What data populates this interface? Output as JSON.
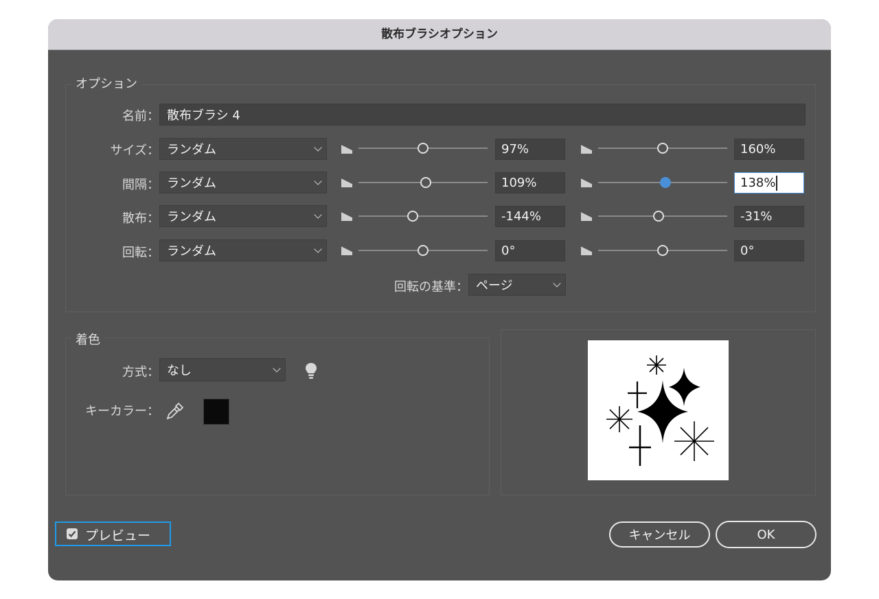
{
  "dialog": {
    "title": "散布ブラシオプション"
  },
  "options": {
    "group_title": "オプション",
    "name_label": "名前：",
    "name_value": "散布ブラシ 4",
    "rows": [
      {
        "label": "サイズ：",
        "method": "ランダム",
        "min_value": "97%",
        "max_value": "160%",
        "min_pos": 0.5,
        "max_pos": 0.5
      },
      {
        "label": "間隔：",
        "method": "ランダム",
        "min_value": "109%",
        "max_value": "138%",
        "min_pos": 0.52,
        "max_pos": 0.52
      },
      {
        "label": "散布：",
        "method": "ランダム",
        "min_value": "-144%",
        "max_value": "-31%",
        "min_pos": 0.42,
        "max_pos": 0.47
      },
      {
        "label": "回転：",
        "method": "ランダム",
        "min_value": "0°",
        "max_value": "0°",
        "min_pos": 0.5,
        "max_pos": 0.5
      }
    ],
    "rotation_basis_label": "回転の基準：",
    "rotation_basis_value": "ページ"
  },
  "coloring": {
    "group_title": "着色",
    "method_label": "方式：",
    "method_value": "なし",
    "key_color_label": "キーカラー：",
    "key_color": "#0a0a0a",
    "tips_icon": "lightbulb-icon",
    "eyedropper_icon": "eyedropper-icon"
  },
  "footer": {
    "preview_label": "プレビュー",
    "preview_checked": true,
    "cancel_label": "キャンセル",
    "ok_label": "OK"
  },
  "colors": {
    "dialog_bg": "#535353",
    "accent": "#4a90d9",
    "focus_outline": "#1e9be8"
  }
}
